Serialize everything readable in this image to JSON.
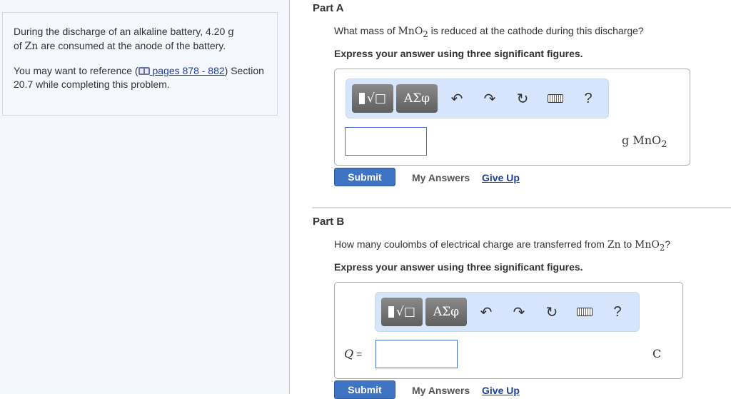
{
  "info": {
    "line1_pre": "During the discharge of an alkaline battery, 4.20 ",
    "unit_g": "g",
    "line2_pre": "of ",
    "zn": "Zn",
    "line2_post": " are consumed at the anode of the battery.",
    "ref_pre": "You may want to reference (",
    "ref_link": "pages 878 - 882",
    "ref_post": ") Section 20.7 while completing this problem."
  },
  "partA": {
    "title": "Part A",
    "q_pre": "What mass of ",
    "q_chem": "MnO",
    "q_sub": "2",
    "q_post": " is reduced at the cathode during this discharge?",
    "instruction": "Express your answer using three significant figures.",
    "unit": "g MnO",
    "unit_sub": "2",
    "submit": "Submit",
    "my_answers": "My Answers",
    "give_up": "Give Up"
  },
  "partB": {
    "title": "Part B",
    "q_pre": "How many coulombs of electrical charge are transferred from ",
    "q_zn": "Zn",
    "q_mid": " to ",
    "q_chem": "MnO",
    "q_sub": "2",
    "q_post": "?",
    "instruction": "Express your answer using three significant figures.",
    "var_label": "Q",
    "eq": " =",
    "unit": "C",
    "submit": "Submit",
    "my_answers": "My Answers",
    "give_up": "Give Up"
  },
  "toolbar": {
    "greek": "ΑΣφ",
    "undo": "↶",
    "redo": "↷",
    "reset": "↻",
    "help": "?"
  }
}
